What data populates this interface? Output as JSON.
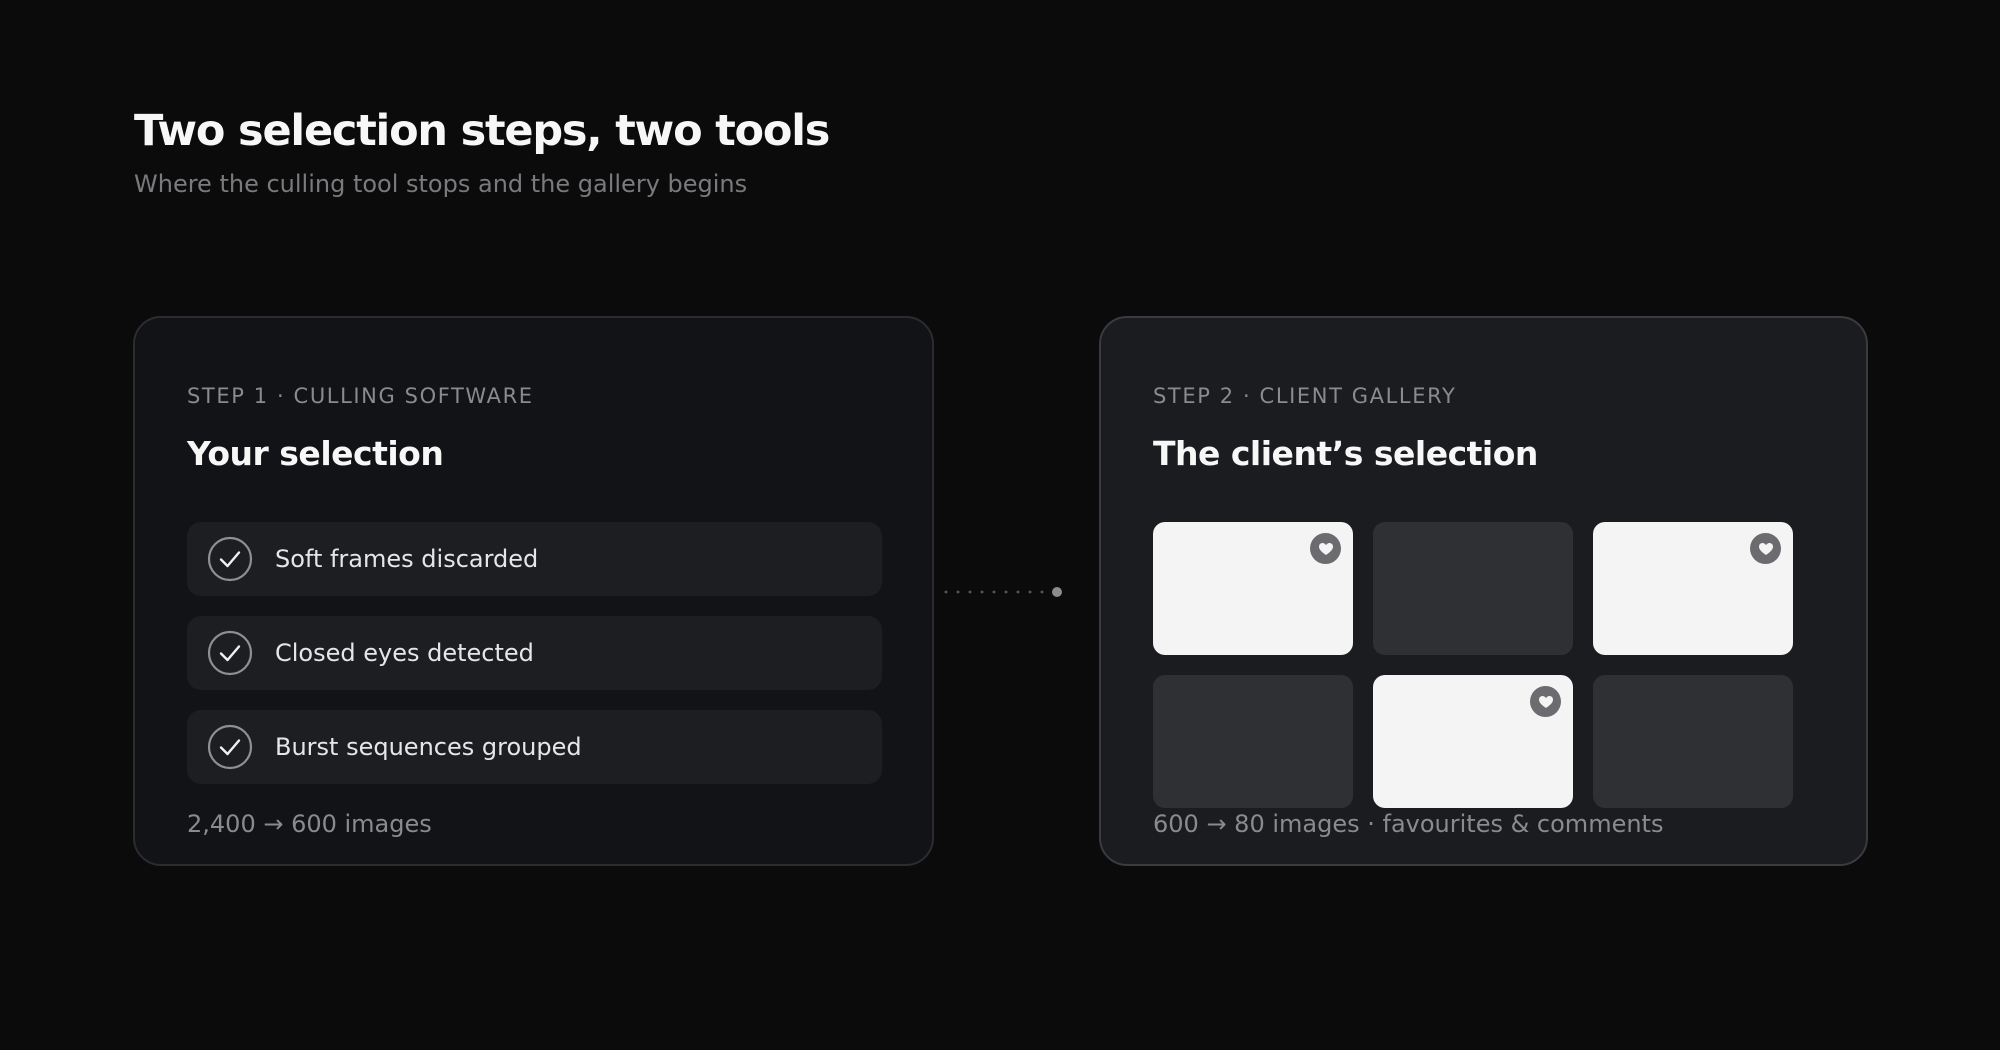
{
  "header": {
    "title": "Two selection steps, two tools",
    "subtitle": "Where the culling tool stops and the gallery begins"
  },
  "step1": {
    "eyebrow": "STEP 1 · CULLING SOFTWARE",
    "title": "Your selection",
    "items": [
      {
        "label": "Soft frames discarded",
        "icon": "check-circle-icon"
      },
      {
        "label": "Closed eyes detected",
        "icon": "check-circle-icon"
      },
      {
        "label": "Burst sequences grouped",
        "icon": "check-circle-icon"
      }
    ],
    "stat": "2,400 → 600 images"
  },
  "step2": {
    "eyebrow": "STEP 2 · CLIENT GALLERY",
    "title": "The client’s selection",
    "thumbnails": [
      {
        "selected": true,
        "icon": "heart-icon"
      },
      {
        "selected": false
      },
      {
        "selected": true,
        "icon": "heart-icon"
      },
      {
        "selected": false
      },
      {
        "selected": true,
        "icon": "heart-icon"
      },
      {
        "selected": false
      }
    ],
    "stat": "600 → 80 images · favourites & comments"
  },
  "colors": {
    "background": "#0b0b0c",
    "card1": "#121316",
    "card2": "#1b1c20",
    "selected_thumb": "#f4f4f4",
    "unselected_thumb": "#2f3034",
    "muted_text": "#8a8a8f"
  }
}
